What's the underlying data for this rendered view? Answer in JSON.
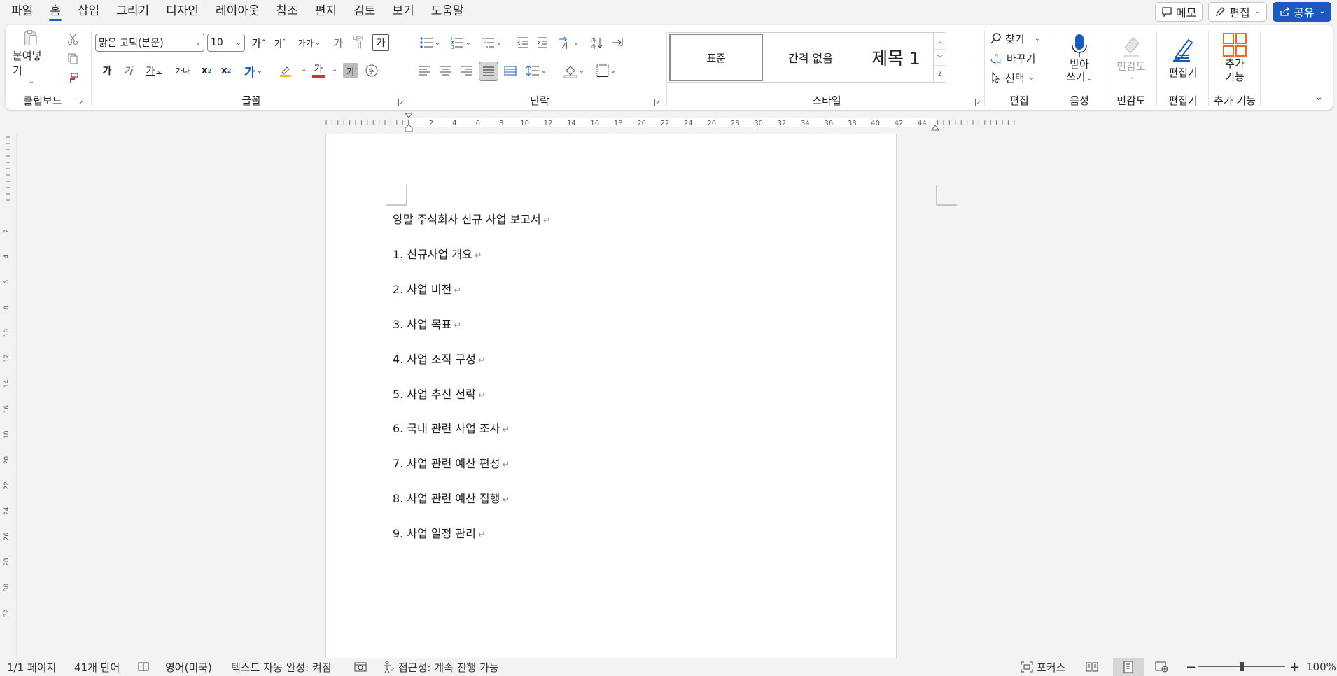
{
  "menu": {
    "items": [
      "파일",
      "홈",
      "삽입",
      "그리기",
      "디자인",
      "레이아웃",
      "참조",
      "편지",
      "검토",
      "보기",
      "도움말"
    ],
    "memo": "메모",
    "edit": "편집",
    "share": "공유"
  },
  "ribbon": {
    "clipboard": {
      "label": "클립보드",
      "paste": "붙여넣기"
    },
    "font": {
      "label": "글꼴",
      "font_name": "맑은 고딕(본문)",
      "font_size": "10",
      "grow": "가",
      "shrink": "가",
      "case": "가가",
      "phonetic": "가",
      "phonetic_small": "내천",
      "border_char": "가",
      "bold": "가",
      "italic": "가",
      "underline": "가",
      "strike": "가나",
      "sub": "x",
      "sup": "x",
      "effects": "가",
      "font_color": "가",
      "shading": "가"
    },
    "paragraph": {
      "label": "단락"
    },
    "styles": {
      "label": "스타일",
      "items": [
        "표준",
        "간격 없음",
        "제목 1"
      ]
    },
    "editing": {
      "label": "편집",
      "find": "찾기",
      "replace": "바꾸기",
      "select": "선택"
    },
    "voice": {
      "label": "음성",
      "dictate_1": "받아",
      "dictate_2": "쓰기"
    },
    "sensitivity": {
      "label": "민감도",
      "button": "민감도"
    },
    "editor": {
      "label": "편집기",
      "button": "편집기"
    },
    "addins": {
      "label": "추가 기능",
      "button_1": "추가",
      "button_2": "기능"
    }
  },
  "ruler": {
    "labels": [
      "2",
      "4",
      "6",
      "8",
      "10",
      "12",
      "14",
      "16",
      "18",
      "20",
      "22",
      "24",
      "26",
      "28",
      "30",
      "32",
      "34",
      "36",
      "38",
      "40",
      "42",
      "44"
    ],
    "v_labels": [
      "2",
      "4",
      "6",
      "8",
      "10",
      "12",
      "14",
      "16",
      "18",
      "20",
      "22",
      "24",
      "26",
      "28",
      "30",
      "32"
    ]
  },
  "document": {
    "paragraphs": [
      "양말 주식회사 신규 사업 보고서",
      "1. 신규사업 개요",
      "2. 사업 비전",
      "3. 사업 목표",
      "4. 사업 조직 구성",
      "5. 사업 추진 전략",
      "6. 국내 관련 사업 조사",
      "7. 사업 관련 예산 편성",
      "8. 사업 관련 예산 집행",
      "9. 사업 일정 관리"
    ],
    "para_mark": "↵"
  },
  "status": {
    "page": "1/1 페이지",
    "words": "41개 단어",
    "language": "영어(미국)",
    "autocomplete": "텍스트 자동 완성: 켜짐",
    "accessibility": "접근성: 계속 진행 가능",
    "focus": "포커스",
    "zoom": "100%"
  },
  "colors": {
    "accent": "#185abd",
    "font_color_bar": "#d13438",
    "highlight_bar": "#ffb900",
    "addin_orange": "#e8692a"
  }
}
